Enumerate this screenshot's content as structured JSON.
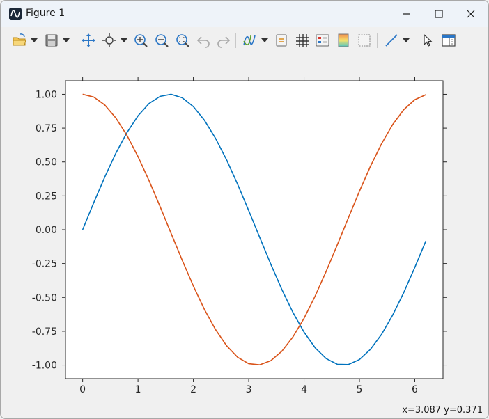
{
  "window": {
    "title": "Figure 1"
  },
  "toolbar": {
    "buttons": [
      "open-icon",
      "save-icon",
      "pan-icon",
      "zoom-icon",
      "zoom-in-icon",
      "zoom-out-icon",
      "zoom-fit-icon",
      "undo-icon",
      "redo-icon",
      "line-style-icon",
      "legend-icon",
      "grid-icon",
      "tick-labels-icon",
      "colormap-icon",
      "frame-icon",
      "draw-line-icon",
      "select-icon",
      "panel-icon"
    ]
  },
  "status": {
    "coords": "x=3.087 y=0.371"
  },
  "colors": {
    "sin": "#0072bd",
    "cos": "#d95319",
    "accent": "#2a76c6"
  },
  "chart_data": {
    "type": "line",
    "title": "",
    "xlabel": "",
    "ylabel": "",
    "xlim": [
      -0.31,
      6.51
    ],
    "ylim": [
      -1.1,
      1.1
    ],
    "xticks": [
      0,
      1,
      2,
      3,
      4,
      5,
      6
    ],
    "yticks": [
      1.0,
      0.75,
      0.5,
      0.25,
      0.0,
      -0.25,
      -0.5,
      -0.75,
      -1.0
    ],
    "xtick_labels": [
      "0",
      "1",
      "2",
      "3",
      "4",
      "5",
      "6"
    ],
    "ytick_labels": [
      "1.00",
      "0.75",
      "0.50",
      "0.25",
      "0.00",
      "-0.25",
      "-0.50",
      "-0.75",
      "-1.00"
    ],
    "x": [
      0,
      0.2,
      0.4,
      0.6,
      0.8,
      1.0,
      1.2,
      1.4,
      1.6,
      1.8,
      2.0,
      2.2,
      2.4,
      2.6,
      2.8,
      3.0,
      3.2,
      3.4,
      3.6,
      3.8,
      4.0,
      4.2,
      4.4,
      4.6,
      4.8,
      5.0,
      5.2,
      5.4,
      5.6,
      5.8,
      6.0,
      6.2
    ],
    "series": [
      {
        "color": "#0072bd",
        "values": [
          0.0,
          0.199,
          0.389,
          0.565,
          0.717,
          0.841,
          0.932,
          0.985,
          1.0,
          0.974,
          0.909,
          0.808,
          0.675,
          0.516,
          0.335,
          0.141,
          -0.058,
          -0.256,
          -0.443,
          -0.612,
          -0.757,
          -0.872,
          -0.952,
          -0.994,
          -0.996,
          -0.959,
          -0.883,
          -0.773,
          -0.631,
          -0.465,
          -0.279,
          -0.083
        ]
      },
      {
        "color": "#d95319",
        "values": [
          1.0,
          0.98,
          0.921,
          0.825,
          0.697,
          0.54,
          0.362,
          0.17,
          -0.029,
          -0.227,
          -0.416,
          -0.589,
          -0.737,
          -0.857,
          -0.942,
          -0.99,
          -0.998,
          -0.967,
          -0.897,
          -0.791,
          -0.654,
          -0.49,
          -0.307,
          -0.112,
          0.087,
          0.284,
          0.469,
          0.635,
          0.776,
          0.886,
          0.96,
          0.997
        ]
      }
    ]
  }
}
